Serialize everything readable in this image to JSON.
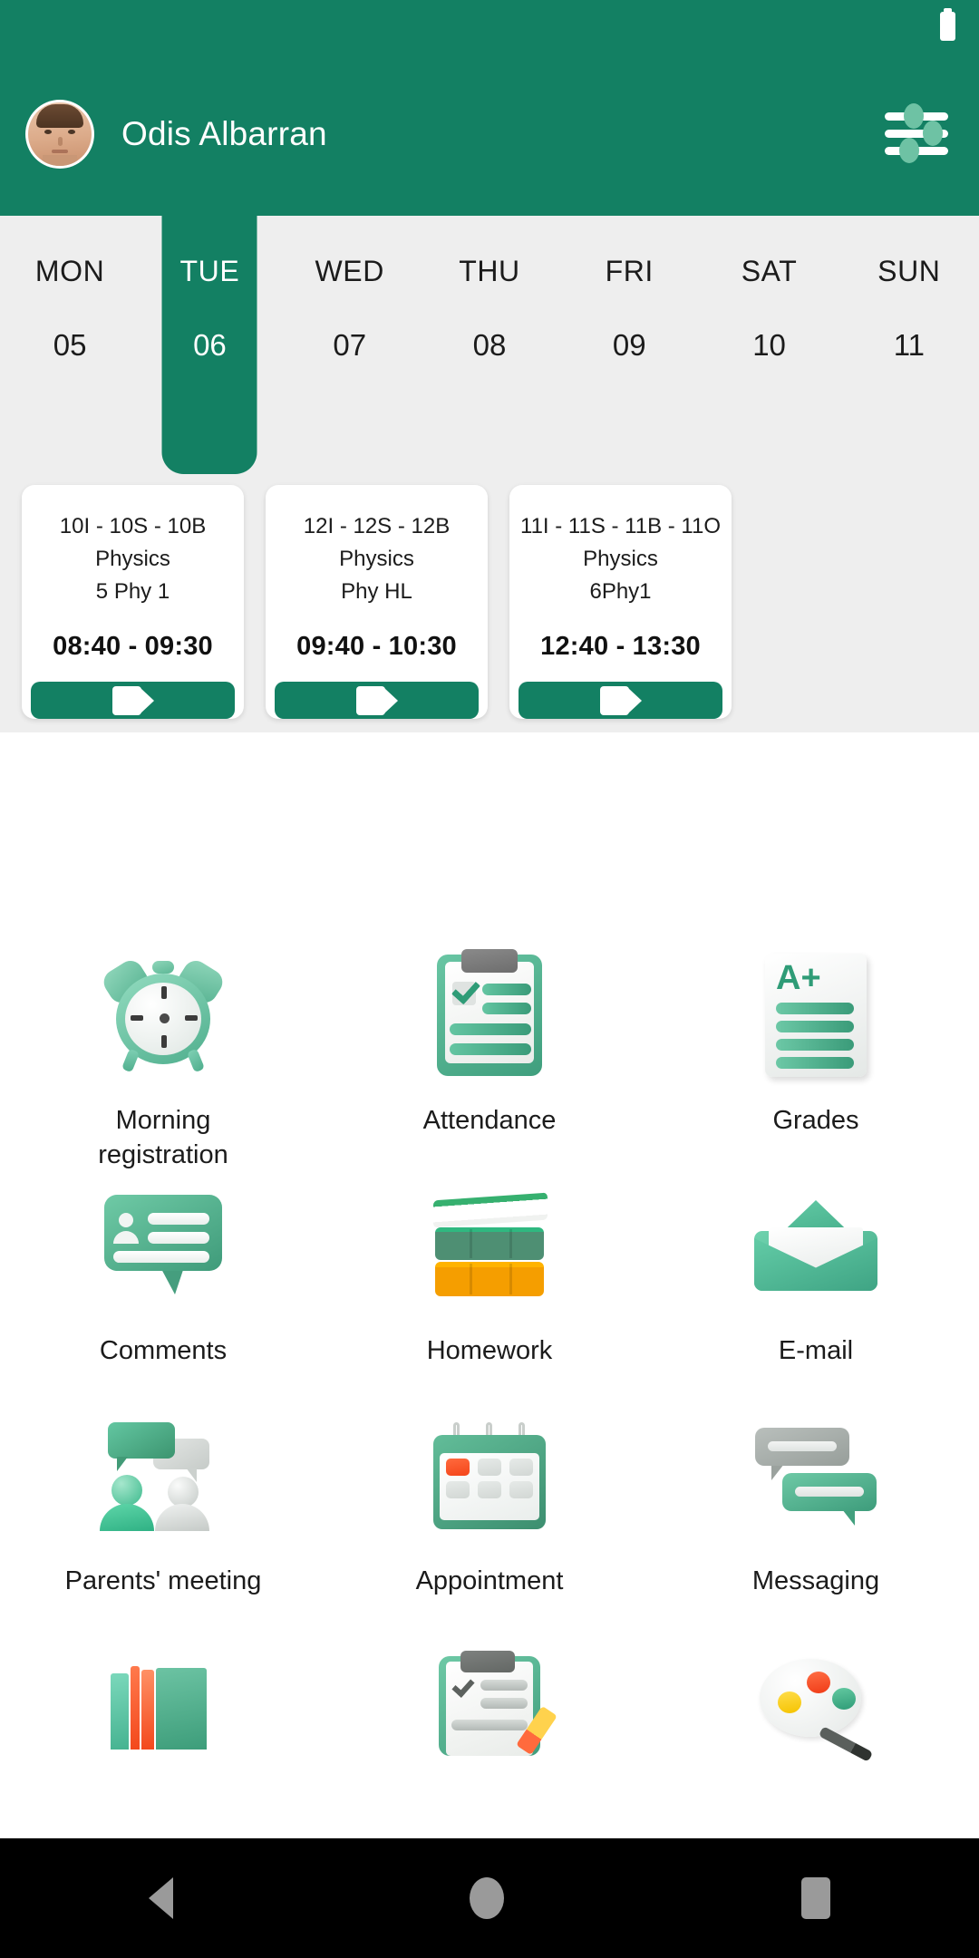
{
  "statusbar": {
    "battery_icon": "battery-icon"
  },
  "appbar": {
    "user_name": "Odis Albarran",
    "avatar_icon": "avatar",
    "settings_icon": "sliders-settings-icon"
  },
  "week": {
    "days": [
      {
        "dow": "MON",
        "date": "05",
        "active": false
      },
      {
        "dow": "TUE",
        "date": "06",
        "active": true
      },
      {
        "dow": "WED",
        "date": "07",
        "active": false
      },
      {
        "dow": "THU",
        "date": "08",
        "active": false
      },
      {
        "dow": "FRI",
        "date": "09",
        "active": false
      },
      {
        "dow": "SAT",
        "date": "10",
        "active": false
      },
      {
        "dow": "SUN",
        "date": "11",
        "active": false
      }
    ]
  },
  "lessons": [
    {
      "classes": "10I - 10S - 10B",
      "subject": "Physics",
      "room": "5 Phy 1",
      "time": "08:40 - 09:30",
      "join_icon": "video-camera-icon"
    },
    {
      "classes": "12I - 12S - 12B",
      "subject": "Physics",
      "room": "Phy HL",
      "time": "09:40 - 10:30",
      "join_icon": "video-camera-icon"
    },
    {
      "classes": "11I - 11S - 11B - 11O",
      "subject": "Physics",
      "room": "6Phy1",
      "time": "12:40 - 13:30",
      "join_icon": "video-camera-icon"
    }
  ],
  "menu": {
    "items": [
      {
        "label": "Morning\nregistration",
        "icon": "alarm-clock-icon"
      },
      {
        "label": "Attendance",
        "icon": "clipboard-check-icon"
      },
      {
        "label": "Grades",
        "icon": "a-plus-document-icon"
      },
      {
        "label": "Comments",
        "icon": "comment-bubble-icon"
      },
      {
        "label": "Homework",
        "icon": "book-stack-icon"
      },
      {
        "label": "E-mail",
        "icon": "open-envelope-icon"
      },
      {
        "label": "Parents' meeting",
        "icon": "two-people-chat-icon"
      },
      {
        "label": "Appointment",
        "icon": "calendar-icon"
      },
      {
        "label": "Messaging",
        "icon": "chat-bubbles-icon"
      },
      {
        "label": "",
        "icon": "bookshelf-icon"
      },
      {
        "label": "",
        "icon": "clipboard-pen-icon"
      },
      {
        "label": "",
        "icon": "paint-palette-icon"
      }
    ]
  },
  "navbar": {
    "back_icon": "back-triangle-icon",
    "home_icon": "home-circle-icon",
    "recent_icon": "recents-square-icon"
  },
  "colors": {
    "brand_green": "#138063",
    "strip_bg": "#eeeeee",
    "card_bg": "#ffffff",
    "nav_bg": "#000000"
  }
}
